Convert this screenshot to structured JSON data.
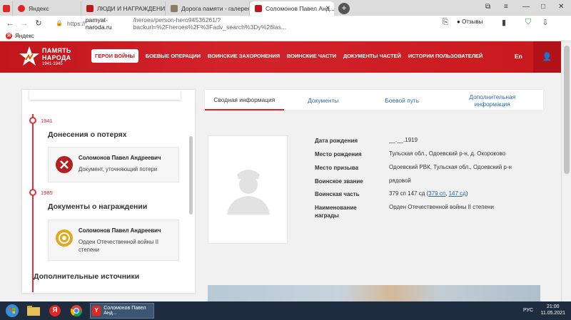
{
  "browser": {
    "tabs": [
      {
        "label": "Яндекс"
      },
      {
        "label": "ЛЮДИ И НАГРАЖДЕНИЯ"
      },
      {
        "label": "Дорога памяти - галерея"
      },
      {
        "label": "Соломонов Павел Анд..."
      }
    ],
    "new_tab": "+",
    "url_host": "pamyat-naroda.ru",
    "url_prefix": "https://",
    "url_path": "/heroes/person-hero94536261/?backurl=%2Fheroes%2F%3Fadv_search%3Dy%26las...",
    "reviews_label": "Отзывы",
    "bookmark": "Яндекс"
  },
  "site": {
    "logo_line1": "ПАМЯТЬ",
    "logo_line2": "НАРОДА",
    "logo_years": "1941-1945",
    "nav": [
      {
        "label": "ГЕРОИ ВОЙНЫ"
      },
      {
        "label": "БОЕВЫЕ ОПЕРАЦИИ"
      },
      {
        "label": "ВОИНСКИЕ ЗАХОРОНЕНИЯ"
      },
      {
        "label": "ВОИНСКИЕ ЧАСТИ"
      },
      {
        "label": "ДОКУМЕНТЫ ЧАСТЕЙ"
      },
      {
        "label": "ИСТОРИИ ПОЛЬЗОВАТЕЛЕЙ"
      }
    ],
    "lang": "En"
  },
  "timeline": {
    "entries": [
      {
        "year": "1941",
        "title": "Донесения о потерях",
        "card_name": "Соломонов Павел Андреевич",
        "card_desc": "Документ, уточняющий потери"
      },
      {
        "year": "1985",
        "title": "Документы о награждении",
        "card_name": "Соломонов Павел Андреевич",
        "card_desc": "Орден Отечественной войны II степени"
      }
    ],
    "extra_title": "Дополнительные источники"
  },
  "tabs": [
    {
      "label": "Сводная информация"
    },
    {
      "label": "Документы"
    },
    {
      "label": "Боевой путь"
    },
    {
      "label": "Дополнительная информация"
    }
  ],
  "info": {
    "rows": [
      {
        "key": "Дата рождения",
        "value": "__.__.1919"
      },
      {
        "key": "Место рождения",
        "value": "Тульская обл., Одоевский р-н, д. Окороково"
      },
      {
        "key": "Место призыва",
        "value": "Одоевский РВК, Тульская обл., Одоевский р-н"
      },
      {
        "key": "Воинское звание",
        "value": "рядовой"
      },
      {
        "key": "Воинская часть",
        "value_prefix": "379 сп 147 сд (",
        "link1": "379 сп",
        "sep": ", ",
        "link2": "147 сд",
        "value_suffix": ")"
      },
      {
        "key": "Наименование награды",
        "value": "Орден Отечественной войны II степени"
      }
    ]
  },
  "taskbar": {
    "active_label": "Соломонов Павел Анд...",
    "lang": "РУС",
    "time": "21:00",
    "date": "11.05.2021"
  },
  "colors": {
    "brand_red": "#c0161c",
    "link_blue": "#2b6cb0"
  }
}
